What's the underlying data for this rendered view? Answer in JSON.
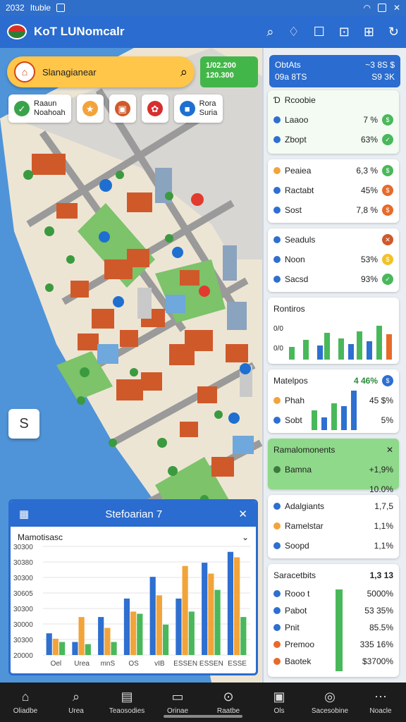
{
  "status": {
    "time": "2032",
    "carrier": "Ituble",
    "icons": [
      "wifi-icon",
      "battery-icon",
      "close-icon"
    ]
  },
  "app": {
    "title": "KoT LUNomcalr",
    "actions": [
      "search-icon",
      "bell-icon",
      "note-icon",
      "chart-icon",
      "mail-icon",
      "refresh-icon"
    ]
  },
  "search": {
    "text": "Slanagianear"
  },
  "greenstat": {
    "line1": "1/02.200",
    "line2": "120.300"
  },
  "chips": [
    {
      "l1": "Raaun",
      "l2": "Noahoah"
    },
    {
      "l1": "",
      "l2": ""
    },
    {
      "l1": "",
      "l2": ""
    },
    {
      "l1": "",
      "l2": ""
    },
    {
      "l1": "Rora",
      "l2": "Suria"
    }
  ],
  "fab": {
    "label": "S"
  },
  "bottom_chart": {
    "title": "Stefoarian 7",
    "prefix": "7",
    "subtitle": "Mamotisasc",
    "close": "✕"
  },
  "chart_data": {
    "type": "bar",
    "categories": [
      "Oel",
      "Urea",
      "mnS",
      "OS",
      "vIB",
      "ESSEN",
      "ESSEN",
      "ESSE"
    ],
    "ytick_labels": [
      "30300",
      "30380",
      "30300",
      "30605",
      "30300",
      "30000",
      "30300",
      "20000"
    ],
    "series": [
      {
        "values": [
          2,
          1.2,
          3.5,
          5.2,
          7.2,
          5.2,
          8.5,
          9.5
        ]
      },
      {
        "values": [
          1.5,
          3.5,
          2.5,
          4.0,
          5.5,
          8.2,
          7.5,
          9.0
        ]
      },
      {
        "values": [
          1.2,
          1.0,
          1.2,
          3.8,
          2.8,
          4.0,
          6.0,
          3.5
        ]
      }
    ],
    "ylim": [
      0,
      10
    ],
    "colors": [
      "#2e6fd0",
      "#f2a43a",
      "#49b85a"
    ]
  },
  "panel": {
    "header": {
      "l1": "ObtAts",
      "r1": "~3 8S $",
      "l2": "09a 8TS",
      "r2": "S9 3K"
    },
    "cards": [
      {
        "title": "Rcoobie",
        "rows": [
          {
            "label": "Laaoo",
            "value": "7 %"
          },
          {
            "label": "Zbopt",
            "value": "63%"
          }
        ]
      },
      {
        "title": "",
        "rows": [
          {
            "label": "Peaiea",
            "value": "6,3 %"
          },
          {
            "label": "Ractabt",
            "value": "45%"
          },
          {
            "label": "Sost",
            "value": "7,8 %"
          }
        ]
      },
      {
        "title": "",
        "rows": [
          {
            "label": "Seaduls",
            "value": ""
          },
          {
            "label": "Noon",
            "value": "53%"
          },
          {
            "label": "Sacsd",
            "value": "93%"
          }
        ]
      },
      {
        "title": "Rontiros",
        "rows": [
          {
            "label": "0/0",
            "value": ""
          },
          {
            "label": "0/0",
            "value": ""
          }
        ]
      },
      {
        "title": "Matelpos",
        "r": "4 46%",
        "rows": [
          {
            "label": "Phah",
            "value": "45 $%"
          },
          {
            "label": "Sobt",
            "value": "5%"
          }
        ]
      },
      {
        "title": "Ramalomonents",
        "rows": [
          {
            "label": "Bamna",
            "value": "+1,9%"
          },
          {
            "label": "",
            "value": "10.0%"
          }
        ]
      },
      {
        "title": "",
        "rows": [
          {
            "label": "Adalgiants",
            "value": "1,7,5"
          },
          {
            "label": "Ramelstar",
            "value": "1,1%"
          },
          {
            "label": "Soopd",
            "value": "1,1%"
          }
        ]
      },
      {
        "title": "Saracetbits",
        "r": "1,3 13",
        "rows": [
          {
            "label": "Rooo t",
            "value": "5000%"
          },
          {
            "label": "Pabot",
            "value": "53 35%"
          },
          {
            "label": "Pnit",
            "value": "85.5%"
          },
          {
            "label": "Premoo",
            "value": "335 16%"
          },
          {
            "label": "Baotek",
            "value": "$3700%"
          }
        ]
      }
    ]
  },
  "nav": [
    {
      "label": "Oliadbe",
      "icon": "home-icon"
    },
    {
      "label": "Urea",
      "icon": "search-icon"
    },
    {
      "label": "Teaosodies",
      "icon": "calendar-icon"
    },
    {
      "label": "Orinae",
      "icon": "flag-icon"
    },
    {
      "label": "Raatbe",
      "icon": "download-icon"
    },
    {
      "label": "Ols",
      "icon": "box-icon"
    },
    {
      "label": "Sacesobine",
      "icon": "chart-icon"
    },
    {
      "label": "Noacle",
      "icon": "menu-icon"
    }
  ]
}
